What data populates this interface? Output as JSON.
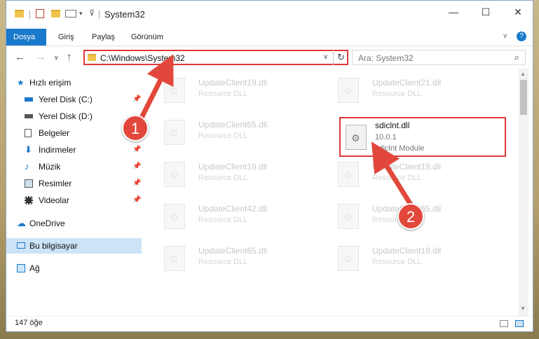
{
  "window": {
    "title": "System32",
    "controls": {
      "minimize": "—",
      "maximize": "☐",
      "close": "✕"
    }
  },
  "ribbon": {
    "tabs": [
      "Dosya",
      "Giriş",
      "Paylaş",
      "Görünüm"
    ]
  },
  "address_bar": {
    "path": "C:\\Windows\\System32",
    "search_placeholder": "Ara: System32"
  },
  "sidebar": {
    "items": [
      {
        "label": "Hızlı erişim",
        "icon": "star-icon",
        "pinned": false
      },
      {
        "label": "Yerel Disk (C:)",
        "icon": "drive-icon",
        "pinned": true
      },
      {
        "label": "Yerel Disk (D:)",
        "icon": "drive-icon",
        "pinned": false
      },
      {
        "label": "Belgeler",
        "icon": "documents-icon",
        "pinned": true
      },
      {
        "label": "İndirmeler",
        "icon": "download-icon",
        "pinned": true
      },
      {
        "label": "Müzik",
        "icon": "music-icon",
        "pinned": true
      },
      {
        "label": "Resimler",
        "icon": "pictures-icon",
        "pinned": true
      },
      {
        "label": "Videolar",
        "icon": "videos-icon",
        "pinned": true
      },
      {
        "label": "OneDrive",
        "icon": "cloud-icon",
        "pinned": false
      },
      {
        "label": "Bu bilgisayar",
        "icon": "computer-icon",
        "pinned": false
      },
      {
        "label": "Ağ",
        "icon": "network-icon",
        "pinned": false
      }
    ]
  },
  "files": [
    {
      "name": "UpdateClient19.dll",
      "desc": "Resource DLL"
    },
    {
      "name": "UpdateClient21.dll",
      "desc": "Resource DLL"
    },
    {
      "name": "UpdateClient65.dll",
      "desc": "Resource DLL"
    },
    {
      "name": "UpdateClient19.dll",
      "desc": "Resource DLL"
    },
    {
      "name": "UpdateClient19.dll",
      "desc": "Resource DLL"
    },
    {
      "name": "UpdateClient42.dll",
      "desc": "Resource DLL"
    },
    {
      "name": "UpdateClient65.dll",
      "desc": "Resource DLL"
    },
    {
      "name": "UpdateClient65.dll",
      "desc": "Resource DLL"
    },
    {
      "name": "UpdateClient19.dll",
      "desc": "Resource DLL"
    }
  ],
  "highlighted_file": {
    "name": "sdiclnt.dll",
    "version": "10.0.1",
    "desc": "sdiclnt Module"
  },
  "status": {
    "count": "147 öğe"
  },
  "annotations": {
    "step1": "1",
    "step2": "2",
    "color": "#e2473b"
  }
}
